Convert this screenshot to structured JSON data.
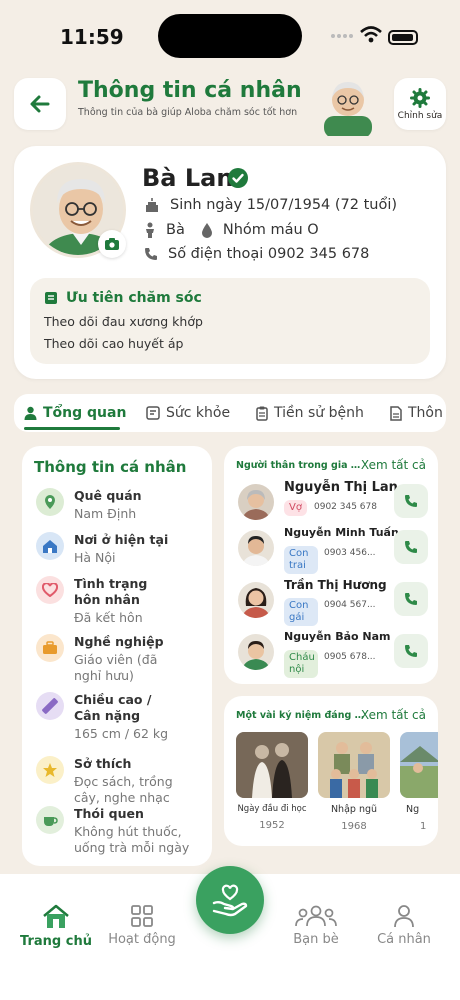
{
  "status_bar": {
    "time": "11:59"
  },
  "header": {
    "title": "Thông tin cá nhân",
    "subtitle": "Thông tin của bà giúp Aloba chăm sóc tốt hơn",
    "edit_label": "Chỉnh sửa"
  },
  "profile": {
    "name": "Bà Lan",
    "birth": "Sinh ngày 15/07/1954 (72 tuổi)",
    "gender": "Bà",
    "blood_type": "Nhóm máu O",
    "phone": "Số điện thoại  0902 345 678",
    "priority_title": "Ưu tiên chăm sóc",
    "priority_items": [
      "Theo dõi đau xương khớp",
      "Theo dõi cao huyết áp"
    ]
  },
  "tabs": [
    {
      "label": "Tổng quan",
      "icon": "person-icon"
    },
    {
      "label": "Sức khỏe",
      "icon": "health-card-icon"
    },
    {
      "label": "Tiền sử bệnh",
      "icon": "clipboard-icon"
    },
    {
      "label": "Thôn",
      "icon": "document-icon"
    }
  ],
  "personal_info": {
    "title": "Thông tin cá nhân",
    "items": [
      {
        "label": "Quê quán",
        "value": "Nam Định",
        "icon": "location-icon",
        "color": "#dcecd4"
      },
      {
        "label": "Nơi ở hiện tại",
        "value": "Hà Nội",
        "icon": "home-icon",
        "color": "#d8e6f6"
      },
      {
        "label": "Tình trạng\nhôn nhân",
        "value": "Đã kết hôn",
        "icon": "heart-icon",
        "color": "#fbe0e0"
      },
      {
        "label": "Nghề nghiệp",
        "value": "Giáo viên (đã\nnghỉ hưu)",
        "icon": "briefcase-icon",
        "color": "#fbe6cc"
      },
      {
        "label": "Chiều cao /\nCân nặng",
        "value": "165 cm / 62 kg",
        "icon": "ruler-icon",
        "color": "#e6ddf4"
      },
      {
        "label": "Sở thích",
        "value": "Đọc sách, trồng\ncây, nghe nhạc",
        "icon": "star-icon",
        "color": "#fbf0c8"
      },
      {
        "label": "Thói quen",
        "value": "Không hút thuốc,\nuống trà mỗi ngày",
        "icon": "teacup-icon",
        "color": "#e2efdc"
      }
    ]
  },
  "family": {
    "title": "Người thân trong gia đình",
    "see_all": "Xem tất cả",
    "members": [
      {
        "name": "Nguyễn Thị Lan",
        "relation": "Vợ",
        "phone": "0902 345 678"
      },
      {
        "name": "Nguyễn Minh Tuấn",
        "relation": "Con trai",
        "phone": "0903 456..."
      },
      {
        "name": "Trần Thị Hương",
        "relation": "Con gái",
        "phone": "0904 567..."
      },
      {
        "name": "Nguyễn Bảo Nam",
        "relation": "Cháu nội",
        "phone": "0905 678..."
      }
    ]
  },
  "memories": {
    "title": "Một vài kỷ niệm đáng nhớ",
    "see_all": "Xem tất cả",
    "photos": [
      {
        "caption": "Ngày đầu đi học",
        "year": "1952"
      },
      {
        "caption": "Nhập ngũ",
        "year": "1968"
      },
      {
        "caption": "Ng",
        "year": "1"
      }
    ]
  },
  "bottom_nav": [
    {
      "label": "Trang chủ",
      "icon": "home-icon"
    },
    {
      "label": "Hoạt động",
      "icon": "grid-icon"
    },
    {
      "label": "Bạn bè",
      "icon": "friends-icon"
    },
    {
      "label": "Cá nhân",
      "icon": "user-icon"
    }
  ],
  "colors": {
    "primary": "#1f7a3c",
    "background": "#f4eee6",
    "fab": "#3aa160"
  }
}
